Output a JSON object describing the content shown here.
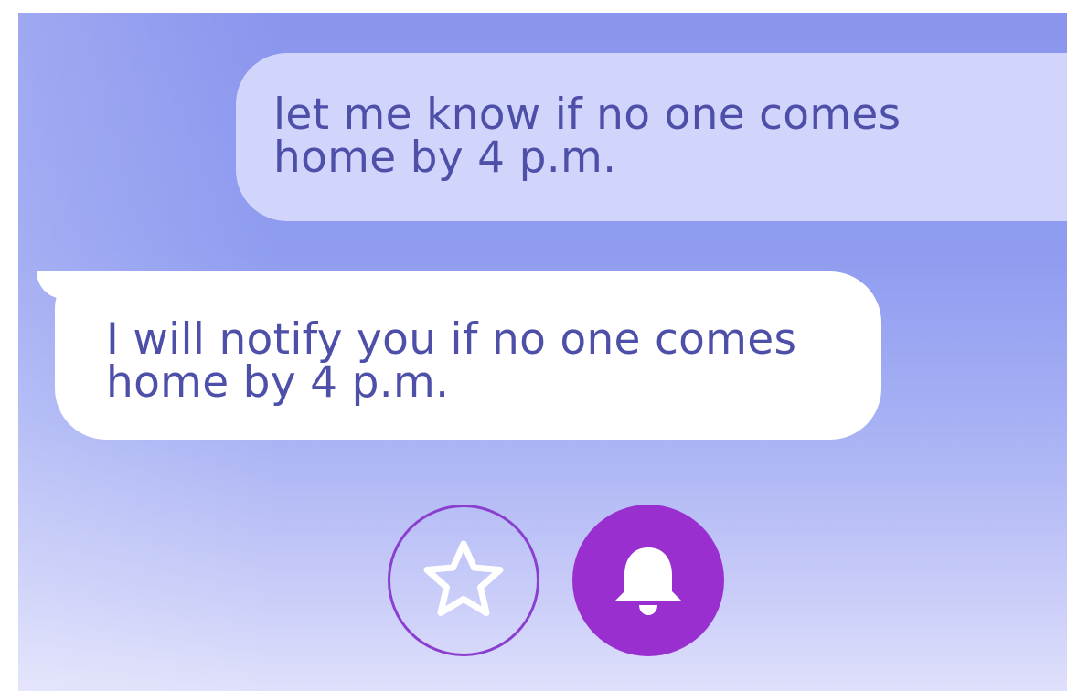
{
  "conversation": {
    "user_message": {
      "lines": [
        "let me know if no one comes",
        "home by 4 p.m."
      ]
    },
    "assistant_message": {
      "lines": [
        "I will notify you if no one comes",
        "home by 4 p.m."
      ]
    }
  },
  "actions": {
    "favorite_icon": "star-outline-icon",
    "reminder_icon": "bell-icon"
  },
  "colors": {
    "background_top": "#8a95ee",
    "background_bottom": "#dfe0fb",
    "user_bubble": "#d2d5fb",
    "assistant_bubble": "#ffffff",
    "text": "#4d4fa8",
    "accent": "#9a2fd0"
  }
}
